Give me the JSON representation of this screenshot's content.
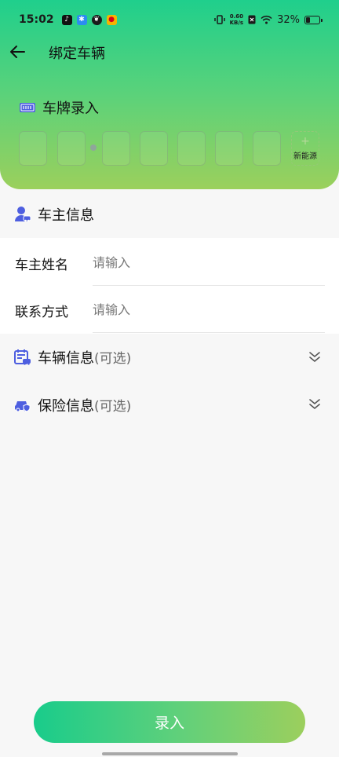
{
  "status_bar": {
    "time": "15:02",
    "net_speed_value": "0.60",
    "net_speed_unit": "KB/s",
    "battery": "32%",
    "battery_level": 0.32
  },
  "nav": {
    "title": "绑定车辆"
  },
  "plate": {
    "title": "车牌录入",
    "new_energy_label": "新能源",
    "new_energy_plus": "+"
  },
  "owner": {
    "title": "车主信息",
    "fields": [
      {
        "label": "车主姓名",
        "placeholder": "请输入"
      },
      {
        "label": "联系方式",
        "placeholder": "请输入"
      }
    ]
  },
  "vehicle": {
    "title": "车辆信息",
    "optional": "(可选)"
  },
  "insurance": {
    "title": "保险信息",
    "optional": "(可选)"
  },
  "submit_label": "录入",
  "colors": {
    "accent_start": "#19cc8b",
    "accent_end": "#9ccf5d",
    "icon_blue": "#4e5fe0"
  }
}
